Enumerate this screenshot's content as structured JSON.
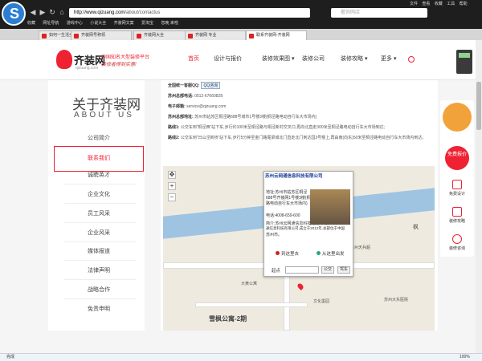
{
  "browser": {
    "back_label": "收藏",
    "address": "www.qizuang.com/about/contactus",
    "address_host": "http://www.qizuang.com",
    "address_path": "/about/contactus",
    "search_placeholder": "奢饰网店",
    "menu": [
      "文件",
      "查看",
      "收藏",
      "工具",
      "帮助"
    ],
    "bookmarks": [
      "收藏",
      "网址导航",
      "游戏中心",
      "小说大全",
      "齐装网文案",
      "爱淘宝",
      "您晚 来啦"
    ],
    "tabs": [
      "如何一生活全",
      "齐装网号称领",
      "齐装网大全",
      "齐装网 专业",
      "联系齐装网-齐装网"
    ]
  },
  "site": {
    "brand_name": "齐装网",
    "brand_url": "qizuang.com",
    "slogan_top": "中国知名大型装修平台",
    "slogan_bottom": "装修者得到实惠!",
    "nav": [
      "首页",
      "设计与报价",
      "装修效果图",
      "装修公司",
      "装修攻略",
      "更多"
    ],
    "nav_arrow": "▾"
  },
  "sidebar": {
    "title": "关于齐装网",
    "subtitle": "ABOUT US",
    "items": [
      "公司简介",
      "联系我们",
      "诚聘英才",
      "企业文化",
      "员工风采",
      "企业风采",
      "媒体报道",
      "法律声明",
      "战略合作",
      "免责申明"
    ]
  },
  "contact": {
    "service_label": "全国统一客服QQ:",
    "qq_button": "QQ咨询",
    "phone_label": "苏州总部电话:",
    "phone": "0512-67660828",
    "email_label": "电子邮箱:",
    "email": "service@qizuang.com",
    "address_label": "苏州总部地址:",
    "address": "苏州市姑苏区桐泾路688号城市1号楼3楼(桐泾路电动自行车大市场内)",
    "route1_label": "路线1:",
    "route1": "公交车到“桐泾西”站下车,步行约100米至桐泾路与桐泾新村交叉口,再向北直走300米至桐泾路电动自行车大市场到达;",
    "route2_label": "路线2:",
    "route2": "公交车到“日山泾新桥”站下车,步行5分钟至金门路尾梁城北门直走北门到达园3号楼上,再由南(向东)50米至桐泾路电动自行车大市场内到达。"
  },
  "map": {
    "bubble_title": "苏州云网通信息科技有限公司",
    "bubble_address": [
      "地址:苏州市姑苏区桐泾",
      "688号齐装网1号楼3楼(桐泾",
      "路电动自行车大市场内)"
    ],
    "bubble_phone": "电话:4008-659-600",
    "bubble_desc": [
      "简介:苏州云网通信息科技有限公司",
      "通信息科技有限公司,成立于2012年,总部位于中国",
      "苏州市。"
    ],
    "to_here": "到这里去",
    "from_here": "从这里出发",
    "start_label": "起点",
    "bus_button": "公交",
    "drive_button": "驾车",
    "labels": [
      "苏州天兵超",
      "枫",
      "苏州大东医院",
      "雪枫公寓-2期",
      "大黄公寓",
      "文化墨园"
    ]
  },
  "float": {
    "free_quote": "免费报价",
    "items": [
      "免费设计",
      "装修攻略",
      "装修咨询"
    ]
  },
  "status": {
    "text": "完成",
    "zoom": "100%"
  }
}
